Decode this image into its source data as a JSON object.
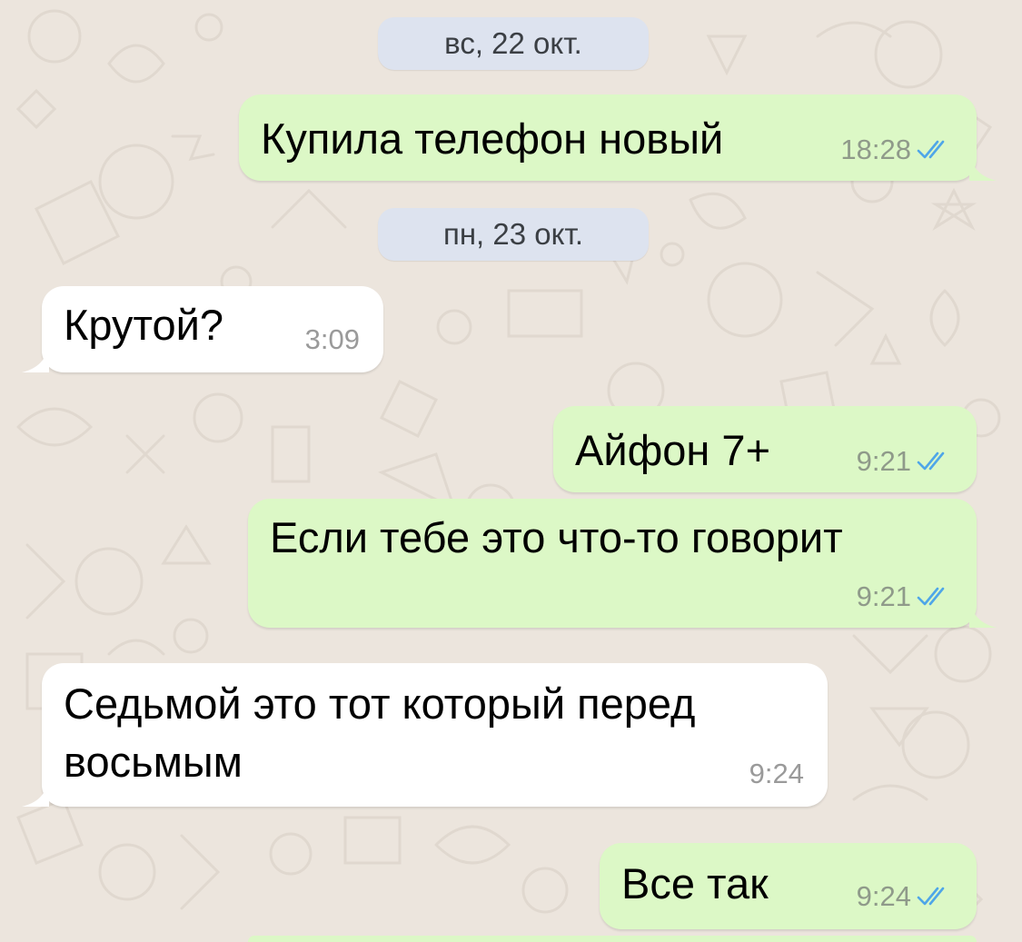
{
  "colors": {
    "background": "#ece5dd",
    "outgoing_bubble": "#dcf8c6",
    "incoming_bubble": "#ffffff",
    "date_pill": "#dde3ef",
    "read_check": "#4fa6e8"
  },
  "dates": [
    {
      "label": "вс, 22 окт."
    },
    {
      "label": "пн, 23 окт."
    }
  ],
  "messages": [
    {
      "direction": "out",
      "text": "Купила телефон новый",
      "time": "18:28",
      "status": "read-double-check-icon"
    },
    {
      "direction": "in",
      "text": "Крутой?",
      "time": "3:09"
    },
    {
      "direction": "out",
      "text": "Айфон 7+",
      "time": "9:21",
      "status": "read-double-check-icon"
    },
    {
      "direction": "out",
      "text": "Если тебе это что-то говорит",
      "time": "9:21",
      "status": "read-double-check-icon"
    },
    {
      "direction": "in",
      "text_line1": "Седьмой это тот который перед",
      "text_line2": "восьмым",
      "time": "9:24"
    },
    {
      "direction": "out",
      "text": "Все так",
      "time": "9:24",
      "status": "read-double-check-icon"
    }
  ]
}
